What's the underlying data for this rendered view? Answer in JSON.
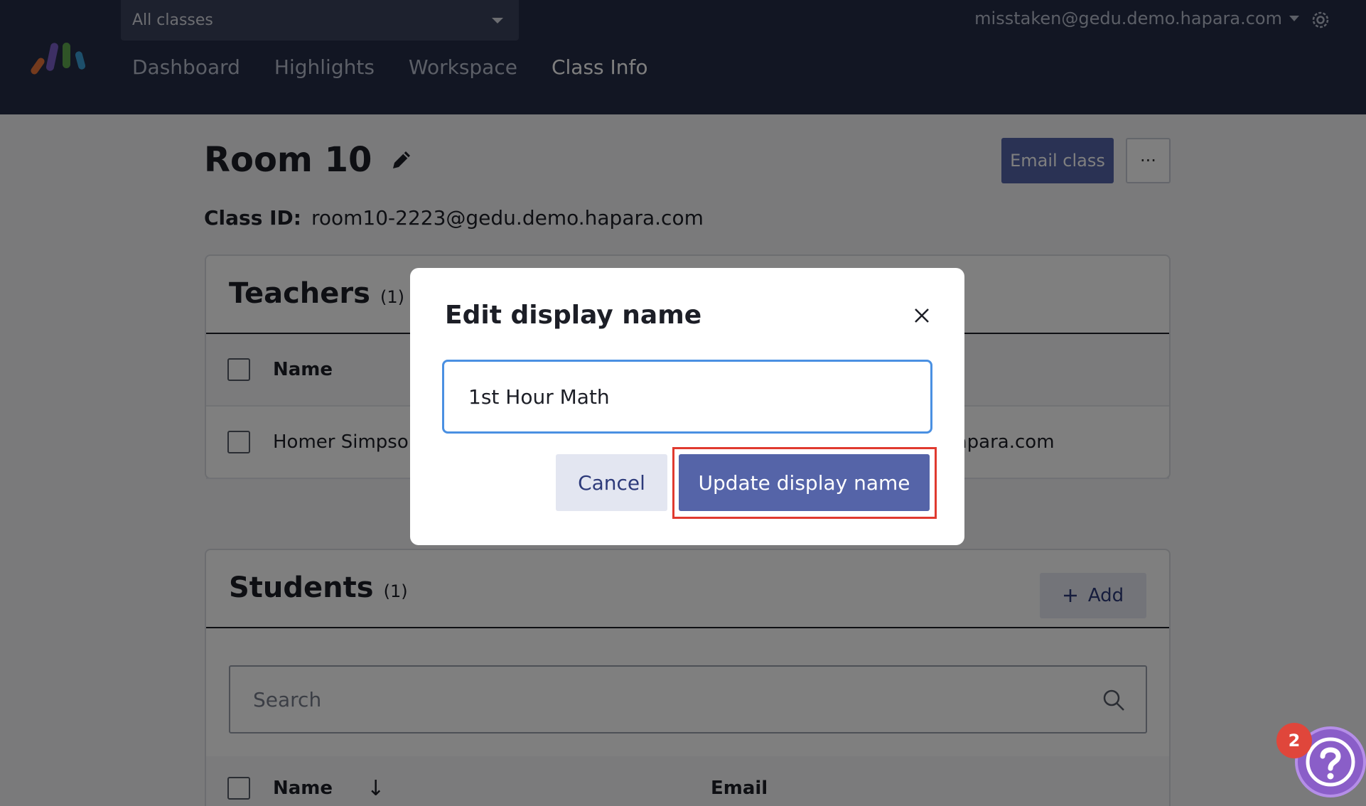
{
  "header": {
    "class_select": "All classes",
    "nav": [
      "Dashboard",
      "Highlights",
      "Workspace",
      "Class Info"
    ],
    "account_email": "misstaken@gedu.demo.hapara.com"
  },
  "page": {
    "title": "Room 10",
    "email_class_label": "Email class",
    "more_label": "···",
    "class_id_label": "Class ID:",
    "class_id_value": "room10-2223@gedu.demo.hapara.com"
  },
  "teachers": {
    "title": "Teachers",
    "count": "(1)",
    "name_header": "Name",
    "rows": [
      {
        "name": "Homer Simpson",
        "email_fragment": ".hapara.com"
      }
    ]
  },
  "students": {
    "title": "Students",
    "count": "(1)",
    "add_label": "Add",
    "search_placeholder": "Search",
    "name_header": "Name",
    "email_header": "Email"
  },
  "modal": {
    "title": "Edit display name",
    "input_value": "1st Hour Math",
    "cancel_label": "Cancel",
    "update_label": "Update display name"
  },
  "help": {
    "badge_count": "2"
  },
  "colors": {
    "header_bg": "#252d46",
    "primary": "#5564a8",
    "focus": "#4a90e2",
    "highlight": "#e03a2f"
  }
}
